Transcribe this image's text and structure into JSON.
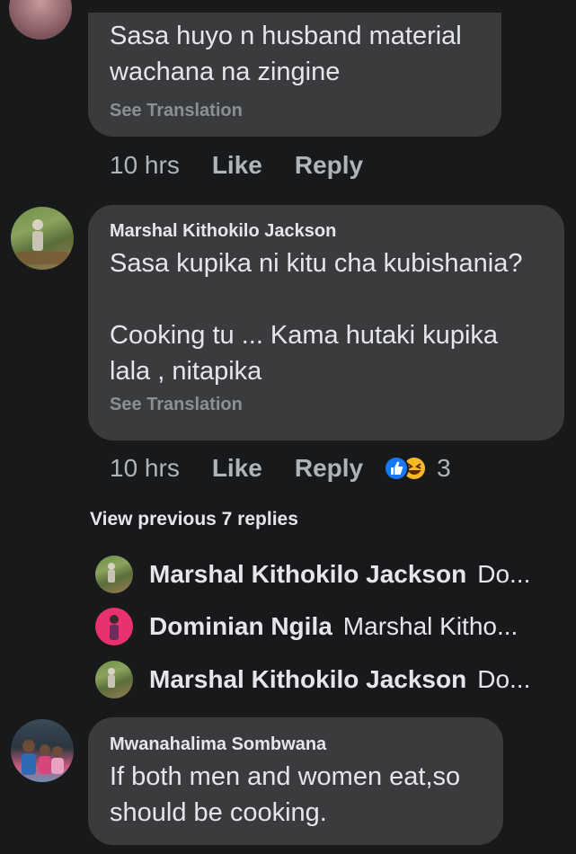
{
  "comment1": {
    "text": "Sasa huyo n husband material\nwachana na zingine",
    "see_translation": "See Translation",
    "time": "10 hrs",
    "like": "Like",
    "reply": "Reply"
  },
  "comment2": {
    "author": "Marshal Kithokilo Jackson",
    "text": "Sasa kupika ni kitu cha kubishania?\n\nCooking tu ... Kama hutaki kupika\nlala , nitapika",
    "see_translation": "See Translation",
    "time": "10 hrs",
    "like": "Like",
    "reply": "Reply",
    "reaction_count": "3"
  },
  "view_previous": "View previous 7 replies",
  "replies": [
    {
      "author": "Marshal Kithokilo Jackson",
      "preview": "Do..."
    },
    {
      "author": "Dominian Ngila",
      "preview": "Marshal Kitho..."
    },
    {
      "author": "Marshal Kithokilo Jackson",
      "preview": "Do..."
    }
  ],
  "comment3": {
    "author": "Mwanahalima Sombwana",
    "text": "If both men and women eat,so\nshould be cooking."
  },
  "colors": {
    "background": "#18191a",
    "bubble": "#3a3b3c",
    "like_blue": "#1877f2",
    "haha_yellow": "#f7b928"
  }
}
